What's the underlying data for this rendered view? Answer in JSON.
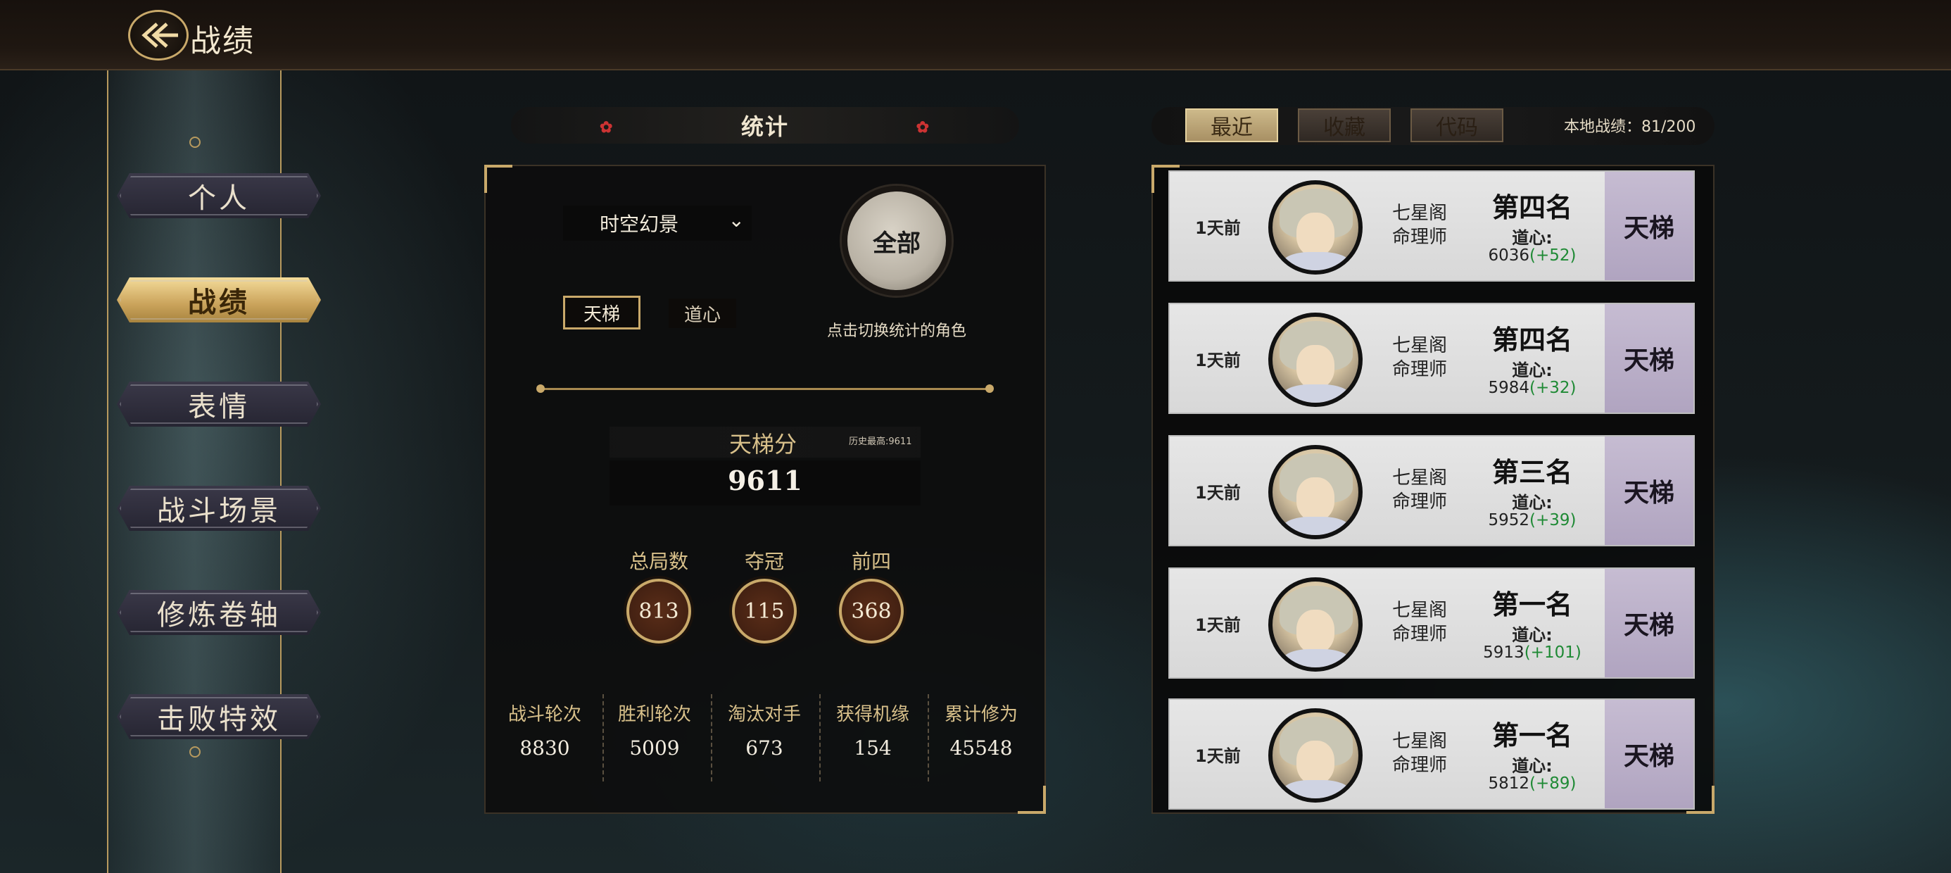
{
  "header": {
    "title": "战绩"
  },
  "sidebar": {
    "items": [
      {
        "label": "个人"
      },
      {
        "label": "战绩"
      },
      {
        "label": "表情"
      },
      {
        "label": "战斗场景"
      },
      {
        "label": "修炼卷轴"
      },
      {
        "label": "击败特效"
      }
    ],
    "active_index": 1
  },
  "stats": {
    "header": "统计",
    "mode_select": "时空幻景",
    "role_button": "全部",
    "role_hint": "点击切换统计的角色",
    "tabs": [
      "天梯",
      "道心"
    ],
    "score_label": "天梯分",
    "best_label": "历史最高:9611",
    "score_value": "9611",
    "counts": [
      {
        "label": "总局数",
        "value": "813"
      },
      {
        "label": "夺冠",
        "value": "115"
      },
      {
        "label": "前四",
        "value": "368"
      }
    ],
    "details": [
      {
        "label": "战斗轮次",
        "value": "8830"
      },
      {
        "label": "胜利轮次",
        "value": "5009"
      },
      {
        "label": "淘汰对手",
        "value": "673"
      },
      {
        "label": "获得机缘",
        "value": "154"
      },
      {
        "label": "累计修为",
        "value": "45548"
      }
    ]
  },
  "records": {
    "tabs": [
      "最近",
      "收藏",
      "代码"
    ],
    "count_label": "本地战绩：81/200",
    "items": [
      {
        "ago": "1天前",
        "sect_line1": "七星阁",
        "sect_line2": "命理师",
        "rank": "第四名",
        "dao_label": "道心:",
        "dao_value": "6036",
        "dao_delta": "(+52)",
        "mode": "天梯"
      },
      {
        "ago": "1天前",
        "sect_line1": "七星阁",
        "sect_line2": "命理师",
        "rank": "第四名",
        "dao_label": "道心:",
        "dao_value": "5984",
        "dao_delta": "(+32)",
        "mode": "天梯"
      },
      {
        "ago": "1天前",
        "sect_line1": "七星阁",
        "sect_line2": "命理师",
        "rank": "第三名",
        "dao_label": "道心:",
        "dao_value": "5952",
        "dao_delta": "(+39)",
        "mode": "天梯"
      },
      {
        "ago": "1天前",
        "sect_line1": "七星阁",
        "sect_line2": "命理师",
        "rank": "第一名",
        "dao_label": "道心:",
        "dao_value": "5913",
        "dao_delta": "(+101)",
        "mode": "天梯"
      },
      {
        "ago": "1天前",
        "sect_line1": "七星阁",
        "sect_line2": "命理师",
        "rank": "第一名",
        "dao_label": "道心:",
        "dao_value": "5812",
        "dao_delta": "(+89)",
        "mode": "天梯"
      }
    ]
  },
  "colors": {
    "gold": "#c9a96a",
    "active_nav": "#e2c57e",
    "card_bg": "#e0e0e0",
    "mode_bg": "#b8accb",
    "delta_green": "#1f8a35"
  }
}
